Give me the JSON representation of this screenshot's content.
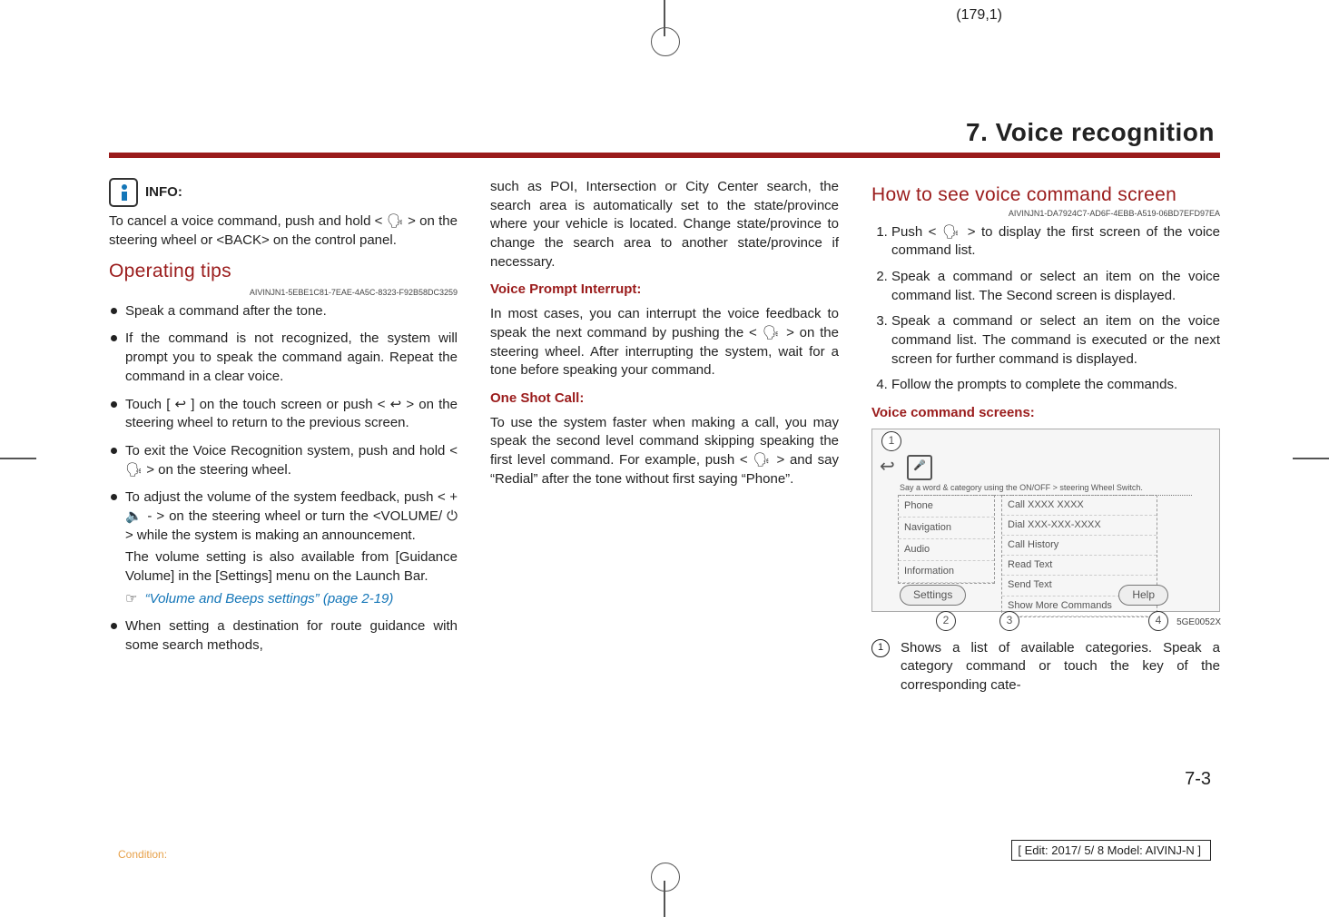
{
  "slip": "(179,1)",
  "section_title": "7. Voice recognition",
  "col1": {
    "info_label": "INFO:",
    "info_para": "To cancel a voice command, push and hold < 🗣 > on the steering wheel or <BACK> on the control panel.",
    "op_heading": "Operating tips",
    "op_id": "AIVINJN1-5EBE1C81-7EAE-4A5C-8323-F92B58DC3259",
    "b1": "Speak a command after the tone.",
    "b2": "If the command is not recognized, the system will prompt you to speak the command again. Repeat the command in a clear voice.",
    "b3": "Touch [ ↩ ] on the touch screen or push < ↩ > on the steering wheel to return to the previous screen.",
    "b4": "To exit the Voice Recognition system, push and hold < 🗣 > on the steering wheel.",
    "b5": "To adjust the volume of the system feedback, push < + 🔈 - > on the steering wheel or turn the <VOLUME/ ⏻ > while the system is making an announcement.",
    "b5b": "The volume setting is also available from [Guidance Volume] in the [Settings] menu on the Launch Bar.",
    "b5_link": "“Volume and Beeps settings” (page 2-19)",
    "b6": "When setting a destination for route guidance with some search methods,"
  },
  "col2": {
    "cont": "such as POI, Intersection or City Center search, the search area is automatically set to the state/province where your vehicle is located. Change state/province to change the search area to another state/province if necessary.",
    "h_interrupt": "Voice Prompt Interrupt:",
    "p_interrupt": "In most cases, you can interrupt the voice feedback to speak the next command by pushing the < 🗣 > on the steering wheel. After interrupting the system, wait for a tone before speaking your command.",
    "h_oneshot": "One Shot Call:",
    "p_oneshot": "To use the system faster when making a call, you may speak the second level command skipping speaking the first level command. For example, push < 🗣 > and say “Redial” after the tone without first saying “Phone”."
  },
  "col3": {
    "h_how": "How to see voice command screen",
    "how_id": "AIVINJN1-DA7924C7-AD6F-4EBB-A519-06BD7EFD97EA",
    "s1": "Push < 🗣 > to display the first screen of the voice command list.",
    "s2": "Speak a command or select an item on the voice command list. The Second screen is displayed.",
    "s3": "Speak a command or select an item on the voice command list. The command is executed or the next screen for further command is displayed.",
    "s4": "Follow the prompts to complete the commands.",
    "h_screens": "Voice command screens:",
    "ss": {
      "caption": "Say a word & category using the ON/OFF > steering Wheel Switch.",
      "left": [
        "Phone",
        "Navigation",
        "Audio",
        "Information"
      ],
      "right": [
        "Call XXXX XXXX",
        "Dial XXX-XXX-XXXX",
        "Call History",
        "Read Text",
        "Send Text",
        "Show More Commands"
      ],
      "settings": "Settings",
      "help": "Help",
      "img_id": "5GE0052X"
    },
    "callout1": "Shows a list of available categories. Speak a category command or touch the key of the corresponding cate-"
  },
  "page_num": "7-3",
  "footer_left": "Condition:",
  "footer_right": "[ Edit: 2017/ 5/ 8   Model: AIVINJ-N ]"
}
